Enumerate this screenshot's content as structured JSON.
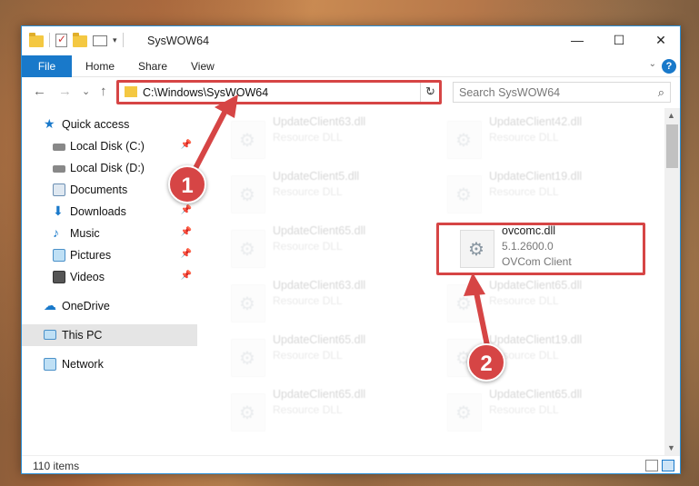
{
  "window": {
    "title": "SysWOW64"
  },
  "titlebar": {
    "minimize": "—",
    "maximize": "☐",
    "close": "✕"
  },
  "ribbon": {
    "tabs": [
      "File",
      "Home",
      "Share",
      "View"
    ],
    "collapse": "⌄",
    "help": "?"
  },
  "nav": {
    "back": "←",
    "forward": "→",
    "recent": "⌄",
    "up": "↑",
    "address": "C:\\Windows\\SysWOW64",
    "address_dropdown": "⌄",
    "refresh": "↻",
    "search_placeholder": "Search SysWOW64",
    "search_icon": "⌕"
  },
  "sidebar": {
    "items": [
      {
        "label": "Quick access",
        "icon": "star-icon",
        "color": "#1979ca",
        "pinned": false
      },
      {
        "label": "Local Disk (C:)",
        "icon": "drive-icon",
        "color": "#666666",
        "pinned": true
      },
      {
        "label": "Local Disk (D:)",
        "icon": "drive-icon",
        "color": "#666666",
        "pinned": true
      },
      {
        "label": "Documents",
        "icon": "documents-icon",
        "color": "#6b8fb3",
        "pinned": true
      },
      {
        "label": "Downloads",
        "icon": "downloads-icon",
        "color": "#1979ca",
        "pinned": true
      },
      {
        "label": "Music",
        "icon": "music-icon",
        "color": "#1979ca",
        "pinned": true
      },
      {
        "label": "Pictures",
        "icon": "pictures-icon",
        "color": "#4a90c8",
        "pinned": true
      },
      {
        "label": "Videos",
        "icon": "videos-icon",
        "color": "#555555",
        "pinned": true
      },
      {
        "label": "OneDrive",
        "icon": "cloud-icon",
        "color": "#1979ca",
        "pinned": false
      },
      {
        "label": "This PC",
        "icon": "computer-icon",
        "color": "#4a90c8",
        "pinned": false
      },
      {
        "label": "Network",
        "icon": "network-icon",
        "color": "#4a90c8",
        "pinned": false
      }
    ],
    "pin_glyph": "📌"
  },
  "files": [
    {
      "name": "UpdateClient63.dll",
      "type": "Resource DLL",
      "detail": ""
    },
    {
      "name": "UpdateClient42.dll",
      "type": "Resource DLL",
      "detail": ""
    },
    {
      "name": "UpdateClient5.dll",
      "type": "Resource DLL",
      "detail": ""
    },
    {
      "name": "UpdateClient19.dll",
      "type": "Resource DLL",
      "detail": ""
    },
    {
      "name": "UpdateClient65.dll",
      "type": "Resource DLL",
      "detail": ""
    },
    {
      "name": "ovcomc.dll",
      "type": "5.1.2600.0",
      "detail": "OVCom Client"
    },
    {
      "name": "UpdateClient63.dll",
      "type": "Resource DLL",
      "detail": ""
    },
    {
      "name": "UpdateClient65.dll",
      "type": "Resource DLL",
      "detail": ""
    },
    {
      "name": "UpdateClient65.dll",
      "type": "Resource DLL",
      "detail": ""
    },
    {
      "name": "UpdateClient19.dll",
      "type": "Resource DLL",
      "detail": ""
    },
    {
      "name": "UpdateClient65.dll",
      "type": "Resource DLL",
      "detail": ""
    },
    {
      "name": "UpdateClient65.dll",
      "type": "Resource DLL",
      "detail": ""
    }
  ],
  "status": {
    "count": "110 items"
  },
  "annotations": {
    "step1": "1",
    "step2": "2",
    "color": "#d64545"
  },
  "scroll": {
    "up": "▲",
    "down": "▼"
  }
}
